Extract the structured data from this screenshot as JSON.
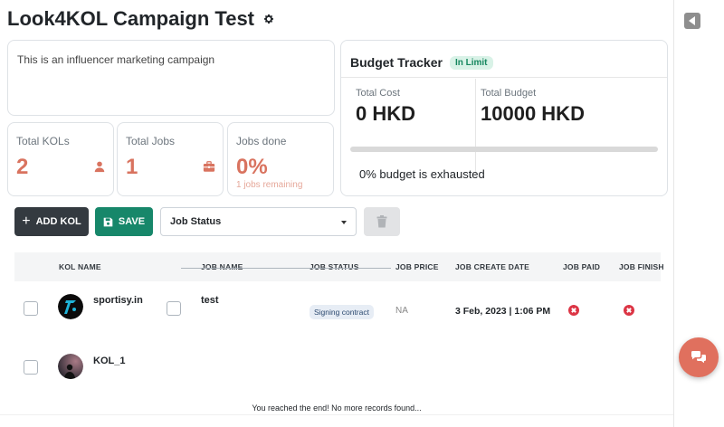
{
  "page": {
    "title": "Look4KOL Campaign Test"
  },
  "campaign": {
    "description": "This is an influencer marketing campaign"
  },
  "stats": {
    "kols": {
      "label": "Total KOLs",
      "value": "2"
    },
    "jobs": {
      "label": "Total Jobs",
      "value": "1"
    },
    "done": {
      "label": "Jobs done",
      "value": "0%",
      "sub": "1 jobs remaining"
    }
  },
  "budget": {
    "title": "Budget Tracker",
    "status": "In Limit",
    "cost_label": "Total Cost",
    "cost_value": "0 HKD",
    "total_label": "Total Budget",
    "total_value": "10000 HKD",
    "progress": 0,
    "exhausted_text": "0% budget is exhausted"
  },
  "toolbar": {
    "add_label": "ADD KOL",
    "save_label": "SAVE",
    "filter_value": "Job Status"
  },
  "table": {
    "columns": [
      "KOL NAME",
      "JOB NAME",
      "JOB STATUS",
      "JOB PRICE",
      "JOB CREATE DATE",
      "JOB PAID",
      "JOB FINISH"
    ],
    "rows": [
      {
        "kol_name": "sportisy.in",
        "job_name": "test",
        "job_status": "Signing contract",
        "job_price": "NA",
        "create_date": "3 Feb, 2023 | 1:06 PM",
        "paid": false,
        "finished": false
      },
      {
        "kol_name": "KOL_1"
      }
    ],
    "end_message": "You reached the end! No more records found..."
  },
  "colors": {
    "accent": "#d9735f",
    "save": "#17876a",
    "dark": "#343a40",
    "danger": "#dc3545",
    "fab": "#e0705e"
  },
  "icons": [
    "gear-icon",
    "user-icon",
    "briefcase-icon",
    "save-icon",
    "trash-icon",
    "x-circle-icon",
    "chat-icon",
    "collapse-icon"
  ]
}
